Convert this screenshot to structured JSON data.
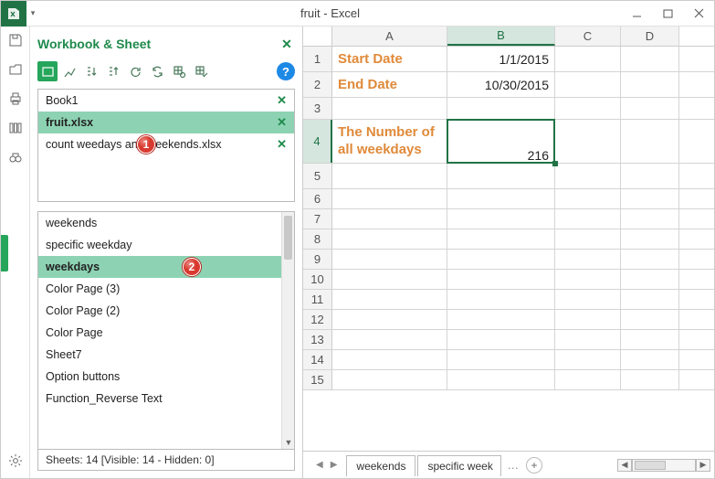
{
  "titlebar": {
    "title": "fruit - Excel"
  },
  "pane": {
    "title": "Workbook & Sheet",
    "status": "Sheets: 14  [Visible: 14 - Hidden: 0]"
  },
  "workbooks": {
    "items": [
      {
        "name": "Book1"
      },
      {
        "name": "fruit.xlsx"
      },
      {
        "name": "count weedays and weekends.xlsx"
      }
    ]
  },
  "sheets": {
    "items": [
      {
        "name": "weekends"
      },
      {
        "name": "specific weekday"
      },
      {
        "name": "weekdays"
      },
      {
        "name": "Color Page (3)"
      },
      {
        "name": "Color Page (2)"
      },
      {
        "name": "Color Page"
      },
      {
        "name": "Sheet7"
      },
      {
        "name": "Option buttons"
      },
      {
        "name": "Function_Reverse Text"
      }
    ]
  },
  "callouts": {
    "one": "1",
    "two": "2"
  },
  "columns": {
    "A": "A",
    "B": "B",
    "C": "C",
    "D": "D"
  },
  "rows": {
    "r1": "1",
    "r2": "2",
    "r3": "3",
    "r4": "4",
    "r5": "5",
    "r6": "6",
    "r7": "7",
    "r8": "8",
    "r9": "9",
    "r10": "10",
    "r11": "11",
    "r12": "12",
    "r13": "13",
    "r14": "14",
    "r15": "15"
  },
  "cells": {
    "A1": "Start Date",
    "B1": "1/1/2015",
    "A2": "End Date",
    "B2": "10/30/2015",
    "A4": "The Number of all weekdays",
    "B4": "216"
  },
  "tabs": {
    "t1": "weekends",
    "t2": "specific week",
    "dots": "…",
    "plus": "+"
  },
  "help": "?"
}
